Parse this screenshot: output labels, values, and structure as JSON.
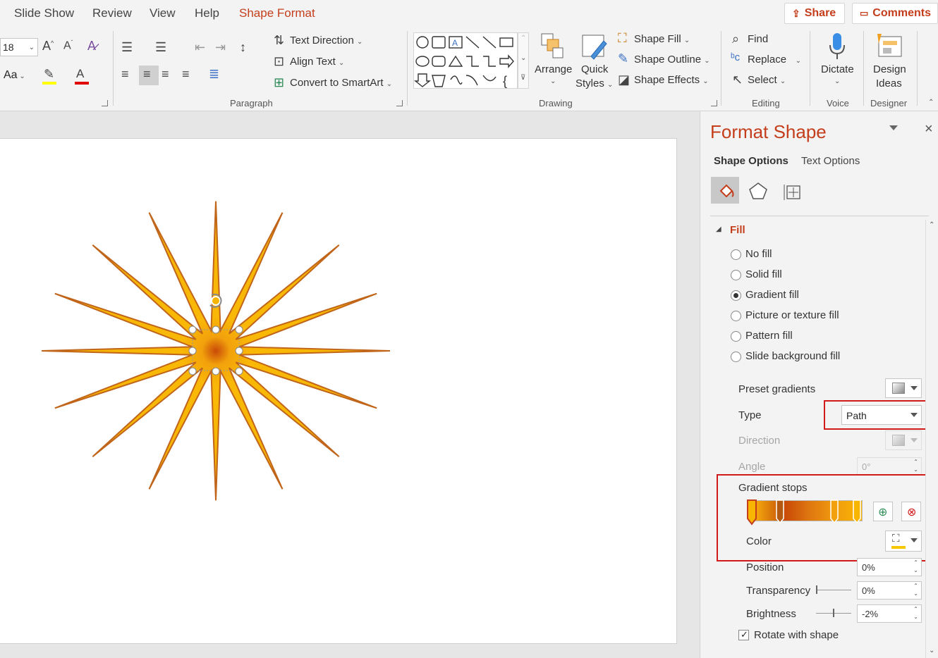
{
  "tabs": [
    "Slide Show",
    "Review",
    "View",
    "Help",
    "Shape Format"
  ],
  "top_buttons": {
    "share": "Share",
    "comments": "Comments"
  },
  "font": {
    "size": "18",
    "case_label": "Aa"
  },
  "ribbon": {
    "text_direction": "Text Direction",
    "align_text": "Align Text",
    "convert_smartart": "Convert to SmartArt",
    "arrange": "Arrange",
    "quick_styles": [
      "Quick",
      "Styles"
    ],
    "shape_fill": "Shape Fill",
    "shape_outline": "Shape Outline",
    "shape_effects": "Shape Effects",
    "find": "Find",
    "replace": "Replace",
    "select": "Select",
    "dictate": "Dictate",
    "design_ideas": [
      "Design",
      "Ideas"
    ]
  },
  "groups": {
    "paragraph": "Paragraph",
    "drawing": "Drawing",
    "editing": "Editing",
    "voice": "Voice",
    "designer": "Designer"
  },
  "pane": {
    "title": "Format Shape",
    "tab_shape": "Shape Options",
    "tab_text": "Text Options",
    "section": "Fill",
    "options": [
      {
        "label": "No fill",
        "selected": false
      },
      {
        "label": "Solid fill",
        "selected": false
      },
      {
        "label": "Gradient fill",
        "selected": true
      },
      {
        "label": "Picture or texture fill",
        "selected": false
      },
      {
        "label": "Pattern fill",
        "selected": false
      },
      {
        "label": "Slide background fill",
        "selected": false
      }
    ],
    "preset_gradients": "Preset gradients",
    "type_label": "Type",
    "type_value": "Path",
    "direction_label": "Direction",
    "angle_label": "Angle",
    "angle_value": "0°",
    "gradient_stops": "Gradient stops",
    "color_label": "Color",
    "position_label": "Position",
    "position_value": "0%",
    "transparency_label": "Transparency",
    "transparency_value": "0%",
    "brightness_label": "Brightness",
    "brightness_value": "-2%",
    "rotate_label": "Rotate with shape",
    "rotate_checked": true
  },
  "colors": {
    "accent": "#c43e1c",
    "highlight_red": "#d11a1a",
    "star_fill": "#f7b500",
    "star_stroke": "#c0651a"
  }
}
